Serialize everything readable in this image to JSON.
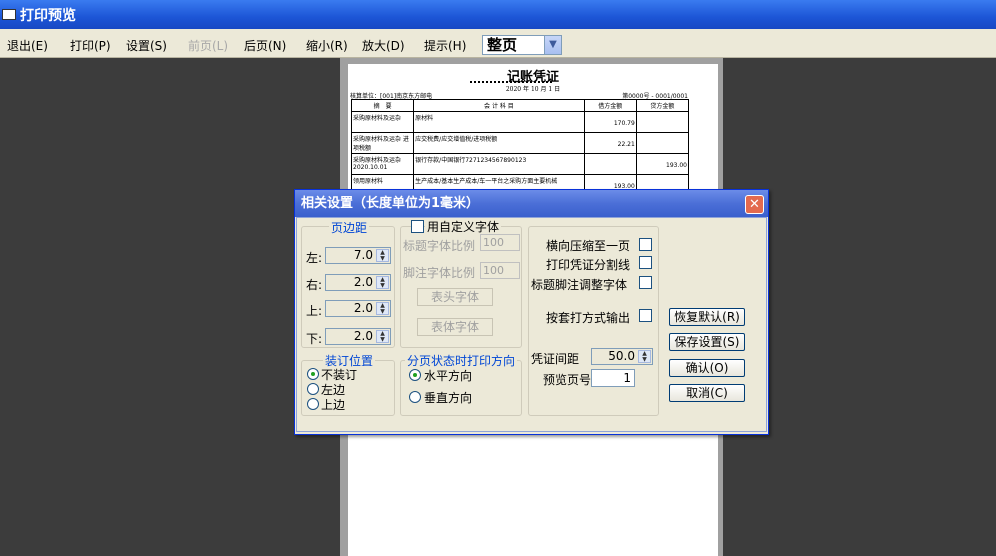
{
  "window": {
    "title": "打印预览"
  },
  "toolbar": {
    "exit": "退出(E)",
    "print": "打印(P)",
    "settings": "设置(S)",
    "prev": "前页(L)",
    "next": "后页(N)",
    "zoom_out": "缩小(R)",
    "zoom_in": "放大(D)",
    "hint": "提示(H)",
    "zoom_value": "整页"
  },
  "voucher": {
    "title": "记账凭证",
    "date": "2020 年 10 月 1 日",
    "unit": "核算单位：[001]南京东方邮电",
    "number": "第0000号 - 0001/0001",
    "headers": [
      "摘　要",
      "会 计 科 目",
      "借方金额",
      "贷方金额"
    ],
    "rows": [
      {
        "summary": "采购原材料及运杂",
        "account": "原材料",
        "debit": "170.79",
        "credit": ""
      },
      {
        "summary": "采购原材料及运杂 进项税额",
        "account": "应交税费/应交增值税/进项税额",
        "debit": "22.21",
        "credit": ""
      },
      {
        "summary": "采购原材料及运杂 2020.10.01",
        "account": "银行存款/中国银行7271234567890123",
        "debit": "",
        "credit": "193.00"
      },
      {
        "summary": "领用原材料",
        "account": "生产成本/基本生产成本/车一平台之采购方面主要机械",
        "debit": "193.00",
        "credit": ""
      }
    ]
  },
  "dialog": {
    "title": "相关设置（长度单位为1毫米）",
    "margins": {
      "label": "页边距",
      "left_label": "左:",
      "left": "7.0",
      "right_label": "右:",
      "right": "2.0",
      "top_label": "上:",
      "top": "2.0",
      "bottom_label": "下:",
      "bottom": "2.0"
    },
    "font": {
      "custom_label": "用自定义字体",
      "title_ratio_label": "标题字体比例",
      "title_ratio": "100",
      "footer_ratio_label": "脚注字体比例",
      "footer_ratio": "100",
      "header_font_btn": "表头字体",
      "body_font_btn": "表体字体"
    },
    "options": {
      "compress": "横向压缩至一页",
      "split_line": "打印凭证分割线",
      "adjust_font": "标题脚注调整字体",
      "overprint": "按套打方式输出"
    },
    "binding": {
      "label": "装订位置",
      "none": "不装订",
      "left": "左边",
      "top": "上边"
    },
    "paging": {
      "label": "分页状态时打印方向",
      "horizontal": "水平方向",
      "vertical": "垂直方向"
    },
    "spacing": {
      "label": "凭证间距",
      "value": "50.0"
    },
    "preview_page": {
      "label": "预览页号",
      "value": "1"
    },
    "buttons": {
      "restore": "恢复默认(R)",
      "save": "保存设置(S)",
      "ok": "确认(O)",
      "cancel": "取消(C)"
    }
  }
}
